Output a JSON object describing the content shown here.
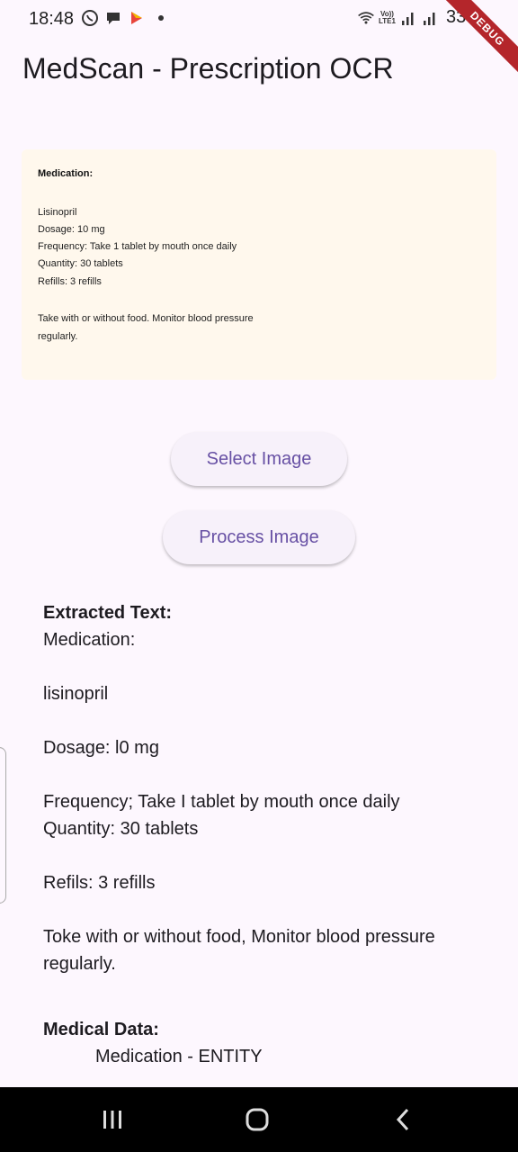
{
  "status_bar": {
    "time": "18:48",
    "battery": "33%",
    "volte_top": "Vo))",
    "volte_bottom": "LTE1",
    "icons": [
      "whatsapp-icon",
      "chat-icon",
      "app-icon",
      "notification-dot",
      "wifi-icon",
      "signal-icon",
      "signal-icon",
      "battery-icon"
    ]
  },
  "debug_banner": "DEBUG",
  "app_bar": {
    "title": "MedScan - Prescription OCR"
  },
  "prescription_image": {
    "heading": "Medication:",
    "lines": [
      "Lisinopril",
      "Dosage: 10 mg",
      "Frequency: Take 1 tablet by mouth once daily",
      "Quantity: 30 tablets",
      "Refills: 3 refills",
      "Take with or without food. Monitor blood pressure",
      "regularly."
    ]
  },
  "buttons": {
    "select_image": "Select Image",
    "process_image": "Process Image"
  },
  "results": {
    "extracted_label": "Extracted Text:",
    "extracted_lines": [
      "Medication:",
      "",
      "lisinopril",
      "",
      "Dosage: l0 mg",
      "",
      "Frequency; Take I tablet by mouth once daily",
      "Quantity: 30 tablets",
      "",
      "Refils: 3 refills",
      "",
      "Toke with or without food, Monitor blood pressure",
      "regularly."
    ],
    "medical_label": "Medical Data:",
    "medical_entity": "Medication - ENTITY"
  },
  "nav_bar": {
    "icons": [
      "recents-icon",
      "home-icon",
      "back-icon"
    ]
  },
  "colors": {
    "background": "#fdf7fe",
    "button_bg": "#f7f1fa",
    "button_text": "#6750a4",
    "image_bg": "#fff8ed",
    "debug_ribbon": "#b4262b",
    "nav_bar": "#000000"
  }
}
